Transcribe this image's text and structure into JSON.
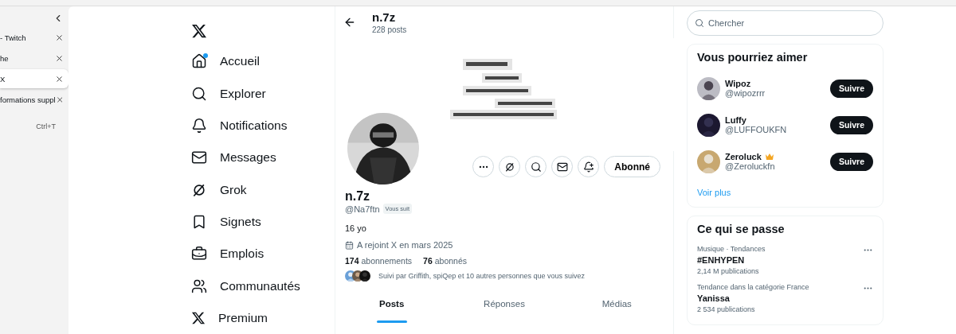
{
  "browser_tabs": {
    "items": [
      {
        "title": "- Twitch",
        "selected": false
      },
      {
        "title": "he",
        "selected": false
      },
      {
        "title": "X",
        "selected": true
      },
      {
        "title": "formations suppl",
        "selected": false
      }
    ],
    "new_tab_shortcut": "Ctrl+T"
  },
  "nav": {
    "items": [
      {
        "kind": "home",
        "label": "Accueil",
        "notify": true
      },
      {
        "kind": "search",
        "label": "Explorer",
        "notify": false
      },
      {
        "kind": "bell",
        "label": "Notifications",
        "notify": false
      },
      {
        "kind": "mail",
        "label": "Messages",
        "notify": false
      },
      {
        "kind": "grok",
        "label": "Grok",
        "notify": false
      },
      {
        "kind": "bookmark",
        "label": "Signets",
        "notify": false
      },
      {
        "kind": "briefcase",
        "label": "Emplois",
        "notify": false
      },
      {
        "kind": "users",
        "label": "Communautés",
        "notify": false
      },
      {
        "kind": "x",
        "label": "Premium",
        "notify": false
      }
    ]
  },
  "profile": {
    "header_name": "n.7z",
    "post_count": "228 posts",
    "actions": [
      {
        "kind": "more"
      },
      {
        "kind": "grok"
      },
      {
        "kind": "search"
      },
      {
        "kind": "mail"
      },
      {
        "kind": "bell"
      }
    ],
    "follow_button": "Abonné",
    "name": "n.7z",
    "handle": "@Na7ftn",
    "follows_you": "Vous suit",
    "bio": "16 yo",
    "joined": "A rejoint X en mars 2025",
    "following_count": "174",
    "following_label": "abonnements",
    "followers_count": "76",
    "followers_label": "abonnés",
    "followed_by": "Suivi par Griffith, spiQep et 10 autres personnes que vous suivez",
    "tabs": [
      {
        "label": "Posts",
        "selected": true
      },
      {
        "label": "Réponses",
        "selected": false
      },
      {
        "label": "Médias",
        "selected": false
      }
    ]
  },
  "search": {
    "placeholder": "Chercher"
  },
  "suggestions": {
    "title": "Vous pourriez aimer",
    "items": [
      {
        "name": "Wipoz",
        "handle": "@wipozrrr",
        "crown": false,
        "button": "Suivre"
      },
      {
        "name": "Luffy",
        "handle": "@LUFFOUKFN",
        "crown": false,
        "button": "Suivre"
      },
      {
        "name": "Zeroluck",
        "handle": "@Zeroluckfn",
        "crown": true,
        "button": "Suivre"
      }
    ],
    "more": "Voir plus"
  },
  "trends": {
    "title": "Ce qui se passe",
    "items": [
      {
        "category": "Musique · Tendances",
        "topic": "#ENHYPEN",
        "count": "2,14 M publications"
      },
      {
        "category": "Tendance dans la catégorie France",
        "topic": "Yanissa",
        "count": "2 534 publications"
      }
    ]
  }
}
